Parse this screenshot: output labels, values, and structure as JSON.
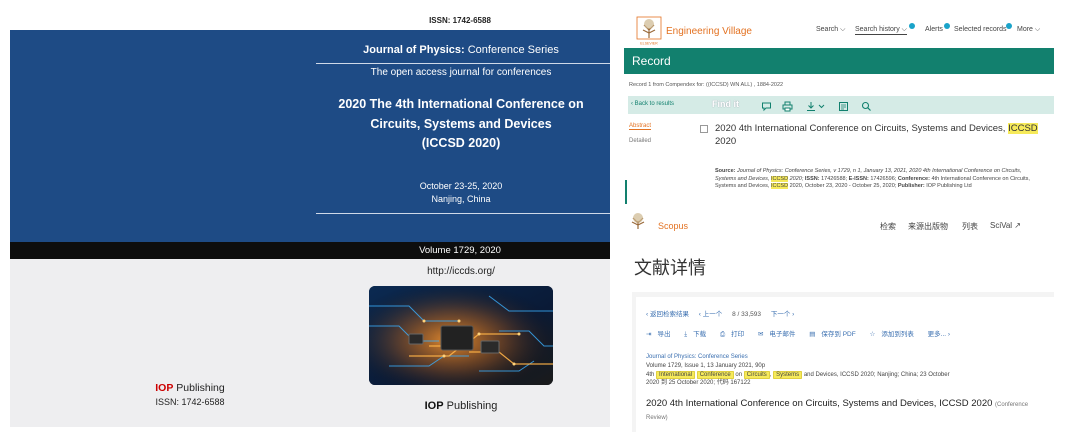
{
  "cover": {
    "issn_top": "ISSN: 1742-6588",
    "journal_bold": "Journal of Physics:",
    "journal_rest": " Conference Series",
    "tagline": "The open access journal for conferences",
    "conf_line1": "2020 The 4th International Conference on",
    "conf_line2": "Circuits, Systems and Devices",
    "conf_line3": "(ICCSD 2020)",
    "date": "October 23-25, 2020",
    "place": "Nanjing, China",
    "volume": "Volume 1729, 2020",
    "url": "http://iccds.org/",
    "publisher_bold": "IOP",
    "publisher_rest": " Publishing",
    "issn_bottom": "ISSN: 1742-6588",
    "colors": {
      "blue": "#1e4b85",
      "black": "#0d0d0d",
      "iop_red": "#cc0000"
    }
  },
  "ev": {
    "brand": "Engineering Village",
    "nav": {
      "search": "Search ⌵",
      "history": "Search history ⌵",
      "alerts": "Alerts",
      "selected": "Selected records",
      "more": "More ⌵"
    },
    "record": "Record",
    "record_line": "Record 1 from Compendex for: ((ICCSD) WN ALL) , 1884-2022",
    "back": "‹ Back to results",
    "findit": "Find it",
    "side_abstract": "Abstract",
    "side_detailed": "Detailed",
    "title_pre": "2020 4th International Conference on Circuits, Systems and Devices, ",
    "title_hl": "ICCSD",
    "title_post": " 2020",
    "source": {
      "l_source": "Source:",
      "journal": "Journal of Physics: Conference Series,",
      "p1": " v 1729, n 1, January 13, 2021, 2020 4th International Conference on Circuits, Systems and Devices, ",
      "hl1": "ICCSD",
      "p2": " 2020;  ",
      "l_issn": "ISSN:",
      "issn": " 17426588;  ",
      "l_eissn": "E-ISSN:",
      "eissn": " 17426596;  ",
      "l_conf": "Conference:",
      "conf": " 4th International Conference on Circuits, Systems and Devices, ",
      "hl2": "ICCSD",
      "p3": " 2020, October 23, 2020 - October 25, 2020;  ",
      "l_pub": "Publisher:",
      "pub": " IOP Publishing Ltd"
    },
    "colors": {
      "green": "#12806e",
      "orange": "#e37222",
      "highlight": "#f6ea5a"
    }
  },
  "scopus": {
    "brand": "Scopus",
    "nav": {
      "search": "检索",
      "sources": "来源出版物",
      "lists": "列表",
      "scival": "SciVal ↗"
    },
    "heading": "文献详情",
    "back": "‹ 返回检索结果",
    "prev": "‹ 上一个",
    "counter": "8 / 33,593",
    "next": "下一个 ›",
    "actions": [
      "导出",
      "下载",
      "打印",
      "电子邮件",
      "保存到 PDF",
      "添加到列表",
      "更多... ›"
    ],
    "journal": "Journal of Physics: Conference Series",
    "meta1": "Volume 1729, Issue 1, 13 January 2021, 90p",
    "meta2_pre": "4th",
    "tag_international": "International",
    "tag_conference": "Conference",
    "word_on": "on",
    "tag_circuits": "Circuits",
    "comma": ",",
    "tag_systems": "Systems",
    "meta2_post": "and Devices, ICCSD 2020; Nanjing; China; 23 October",
    "meta3": "2020 到 25 October 2020; 代码 167122",
    "title": "2020 4th International Conference on Circuits, Systems and Devices, ICCSD 2020",
    "type": "(Conference Review)"
  }
}
